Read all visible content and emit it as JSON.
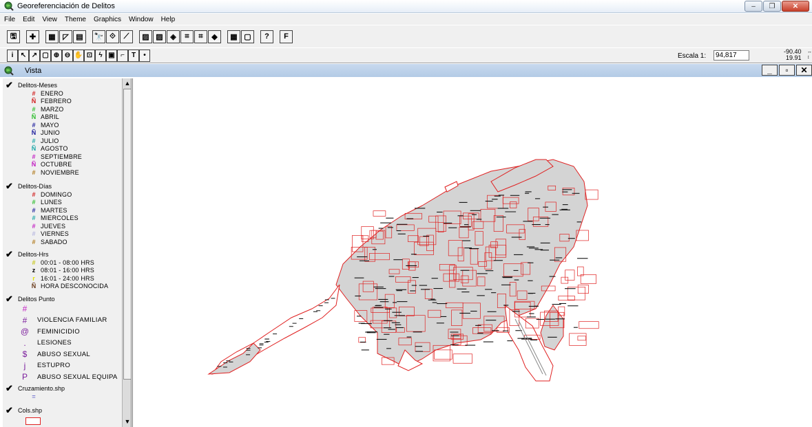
{
  "window": {
    "title": "Georeferenciación de Delitos",
    "min": "–",
    "max": "❐",
    "close": "✕"
  },
  "menu": [
    "File",
    "Edit",
    "View",
    "Theme",
    "Graphics",
    "Window",
    "Help"
  ],
  "toolbar1": [
    {
      "icon": "save-icon",
      "glyph": "🖫"
    },
    {
      "icon": "add-theme-icon",
      "glyph": "✚"
    },
    {
      "icon": "theme-properties-icon",
      "glyph": "▦"
    },
    {
      "icon": "edit-legend-icon",
      "glyph": "◸"
    },
    {
      "icon": "open-table-icon",
      "glyph": "▤"
    },
    {
      "icon": "find-icon",
      "glyph": "🔭"
    },
    {
      "icon": "query-builder-icon",
      "glyph": "⟐"
    },
    {
      "icon": "locate-address-icon",
      "glyph": "⟋"
    },
    {
      "icon": "zoom-full-icon",
      "glyph": "▨"
    },
    {
      "icon": "zoom-active-icon",
      "glyph": "▨"
    },
    {
      "icon": "zoom-selected-icon",
      "glyph": "◈"
    },
    {
      "icon": "zoom-in-fixed-icon",
      "glyph": "⌗"
    },
    {
      "icon": "zoom-out-fixed-icon",
      "glyph": "⌗"
    },
    {
      "icon": "zoom-previous-icon",
      "glyph": "◆"
    },
    {
      "icon": "select-features-icon",
      "glyph": "▦"
    },
    {
      "icon": "clear-selection-icon",
      "glyph": "▢"
    },
    {
      "icon": "help-icon",
      "glyph": "?"
    },
    {
      "icon": "custom-f-button-icon",
      "glyph": "F"
    }
  ],
  "toolbar2": [
    {
      "icon": "identify-icon",
      "glyph": "i"
    },
    {
      "icon": "pointer-icon",
      "glyph": "↖"
    },
    {
      "icon": "vertex-edit-icon",
      "glyph": "↗"
    },
    {
      "icon": "select-feature-icon",
      "glyph": "▢"
    },
    {
      "icon": "zoom-in-icon",
      "glyph": "⊕"
    },
    {
      "icon": "zoom-out-icon",
      "glyph": "⊖"
    },
    {
      "icon": "pan-icon",
      "glyph": "✋"
    },
    {
      "icon": "measure-icon",
      "glyph": "⊡"
    },
    {
      "icon": "hotlink-icon",
      "glyph": "ϟ"
    },
    {
      "icon": "area-of-interest-icon",
      "glyph": "▣"
    },
    {
      "icon": "label-icon",
      "glyph": "⌐"
    },
    {
      "icon": "text-icon",
      "glyph": "T"
    },
    {
      "icon": "draw-point-icon",
      "glyph": "•"
    }
  ],
  "scale": {
    "label": "Escala 1:",
    "value": "94,817"
  },
  "coords": {
    "x": "-90.40",
    "y": "19.91"
  },
  "view": {
    "title": "Vista",
    "min": "_",
    "max": "▫",
    "close": "✕"
  },
  "toc": {
    "themes": [
      {
        "name": "Delitos-Meses",
        "checked": true,
        "items": [
          {
            "sym": "#",
            "color": "#d01c1c",
            "label": "ENERO"
          },
          {
            "sym": "Ñ",
            "color": "#d01c1c",
            "label": "FEBRERO"
          },
          {
            "sym": "#",
            "color": "#2ebd2e",
            "label": "MARZO"
          },
          {
            "sym": "Ñ",
            "color": "#2ebd2e",
            "label": "ABRIL"
          },
          {
            "sym": "#",
            "color": "#1c1c9c",
            "label": "MAYO"
          },
          {
            "sym": "Ñ",
            "color": "#1c1c9c",
            "label": "JUNIO"
          },
          {
            "sym": "#",
            "color": "#1ca6a6",
            "label": "JULIO"
          },
          {
            "sym": "Ñ",
            "color": "#1ca6a6",
            "label": "AGOSTO"
          },
          {
            "sym": "#",
            "color": "#c21cc2",
            "label": "SEPTIEMBRE"
          },
          {
            "sym": "Ñ",
            "color": "#c21cc2",
            "label": "OCTUBRE"
          },
          {
            "sym": "#",
            "color": "#b07a1c",
            "label": "NOVIEMBRE"
          }
        ]
      },
      {
        "name": "Delitos-Días",
        "checked": true,
        "items": [
          {
            "sym": "#",
            "color": "#d01c1c",
            "label": "DOMINGO"
          },
          {
            "sym": "#",
            "color": "#2ebd2e",
            "label": "LUNES"
          },
          {
            "sym": "#",
            "color": "#1c1c9c",
            "label": "MARTES"
          },
          {
            "sym": "#",
            "color": "#1ca6a6",
            "label": "MIERCOLES"
          },
          {
            "sym": "#",
            "color": "#c21cc2",
            "label": "JUEVES"
          },
          {
            "sym": "#",
            "color": "#b8b8e0",
            "label": "VIERNES"
          },
          {
            "sym": "#",
            "color": "#b07a1c",
            "label": "SABADO"
          }
        ]
      },
      {
        "name": "Delitos-Hrs",
        "checked": true,
        "items": [
          {
            "sym": "#",
            "color": "#c8c81c",
            "label": "00:01 - 08:00 HRS"
          },
          {
            "sym": "z",
            "color": "#000000",
            "label": "08:01 - 16:00 HRS"
          },
          {
            "sym": "r",
            "color": "#e0e000",
            "label": "16:01 - 24:00 HRS"
          },
          {
            "sym": "Ñ",
            "color": "#6a3b1c",
            "label": "HORA DESCONOCIDA"
          }
        ]
      },
      {
        "name": "Delitos Punto",
        "checked": true,
        "items": [
          {
            "sym": "#",
            "color": "#c21cc2",
            "label": ""
          },
          {
            "sym": "#",
            "color": "#7a1c9c",
            "label": "VIOLENCIA FAMILIAR"
          },
          {
            "sym": "@",
            "color": "#7a1c9c",
            "label": "FEMINICIDIO"
          },
          {
            "sym": ".",
            "color": "#7a1c9c",
            "label": "LESIONES"
          },
          {
            "sym": "$",
            "color": "#7a1c9c",
            "label": "ABUSO SEXUAL"
          },
          {
            "sym": "j",
            "color": "#7a1c9c",
            "label": "ESTUPRO"
          },
          {
            "sym": "P",
            "color": "#7a1c9c",
            "label": "ABUSO SEXUAL EQUIPA"
          }
        ]
      },
      {
        "name": "Cruzamiento.shp",
        "checked": true,
        "items": [
          {
            "sym": "=",
            "color": "#7a7ad0",
            "label": ""
          }
        ]
      },
      {
        "name": "Cols.shp",
        "checked": true,
        "items": []
      }
    ]
  },
  "colors": {
    "map_outline": "#e02020",
    "map_fill": "#d4d4d4",
    "title_bar": "#dbe6f3",
    "view_bar": "#bdd2ea"
  }
}
